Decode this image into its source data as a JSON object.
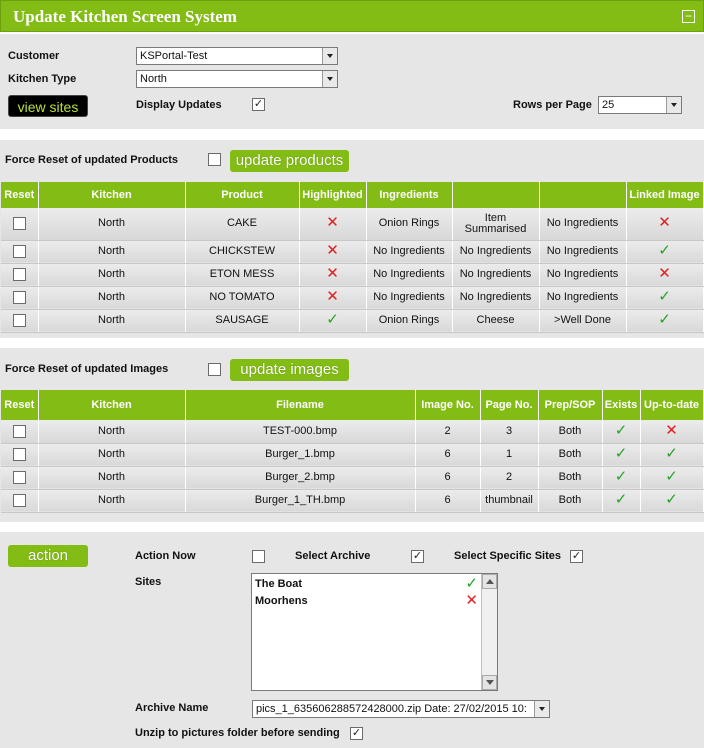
{
  "header": {
    "title": "Update Kitchen Screen System",
    "collapse_glyph": "−"
  },
  "filters": {
    "customer_label": "Customer",
    "customer_value": "KSPortal-Test",
    "kitchen_type_label": "Kitchen Type",
    "kitchen_type_value": "North",
    "view_sites_label": "view sites",
    "display_updates_label": "Display Updates",
    "display_updates_checked": "✓",
    "rows_per_page_label": "Rows per Page",
    "rows_per_page_value": "25"
  },
  "products": {
    "force_reset_label": "Force Reset of updated Products",
    "update_button_label": "update products",
    "columns": [
      "Reset",
      "Kitchen",
      "Product",
      "Highlighted",
      "Ingredients",
      "",
      "",
      "Linked Image"
    ],
    "rows": [
      {
        "kitchen": "North",
        "product": "CAKE",
        "highlighted": "✕",
        "ing1": "Onion Rings",
        "ing2": "Item Summarised",
        "ing3": "No Ingredients",
        "linked": "✕"
      },
      {
        "kitchen": "North",
        "product": "CHICKSTEW",
        "highlighted": "✕",
        "ing1": "No Ingredients",
        "ing2": "No Ingredients",
        "ing3": "No Ingredients",
        "linked": "✓"
      },
      {
        "kitchen": "North",
        "product": "ETON MESS",
        "highlighted": "✕",
        "ing1": "No Ingredients",
        "ing2": "No Ingredients",
        "ing3": "No Ingredients",
        "linked": "✕"
      },
      {
        "kitchen": "North",
        "product": "NO TOMATO",
        "highlighted": "✕",
        "ing1": "No Ingredients",
        "ing2": "No Ingredients",
        "ing3": "No Ingredients",
        "linked": "✓"
      },
      {
        "kitchen": "North",
        "product": "SAUSAGE",
        "highlighted": "✓",
        "ing1": "Onion Rings",
        "ing2": "Cheese",
        "ing3": ">Well Done",
        "linked": "✓"
      }
    ]
  },
  "images": {
    "force_reset_label": "Force Reset of updated Images",
    "update_button_label": "update images",
    "columns": [
      "Reset",
      "Kitchen",
      "Filename",
      "Image No.",
      "Page No.",
      "Prep/SOP",
      "Exists",
      "Up-to-date"
    ],
    "rows": [
      {
        "kitchen": "North",
        "filename": "TEST-000.bmp",
        "image_no": "2",
        "page_no": "3",
        "prep": "Both",
        "exists": "✓",
        "uptodate": "✕"
      },
      {
        "kitchen": "North",
        "filename": "Burger_1.bmp",
        "image_no": "6",
        "page_no": "1",
        "prep": "Both",
        "exists": "✓",
        "uptodate": "✓"
      },
      {
        "kitchen": "North",
        "filename": "Burger_2.bmp",
        "image_no": "6",
        "page_no": "2",
        "prep": "Both",
        "exists": "✓",
        "uptodate": "✓"
      },
      {
        "kitchen": "North",
        "filename": "Burger_1_TH.bmp",
        "image_no": "6",
        "page_no": "thumbnail",
        "prep": "Both",
        "exists": "✓",
        "uptodate": "✓"
      }
    ]
  },
  "action": {
    "button_label": "action",
    "action_now_label": "Action Now",
    "select_archive_label": "Select Archive",
    "select_archive_checked": "✓",
    "select_specific_sites_label": "Select Specific Sites",
    "select_specific_sites_checked": "✓",
    "sites_label": "Sites",
    "sites": [
      {
        "name": "The Boat",
        "state": "✓"
      },
      {
        "name": "Moorhens",
        "state": "✕"
      }
    ],
    "archive_name_label": "Archive Name",
    "archive_name_value": "pics_1_635606288572428000.zip Date: 27/02/2015 10:",
    "unzip_label": "Unzip to pictures folder before sending",
    "unzip_checked": "✓"
  },
  "colors": {
    "accent": "#84bc16",
    "panel": "#e6e6e6",
    "ok": "#26a326",
    "error": "#e02020"
  }
}
